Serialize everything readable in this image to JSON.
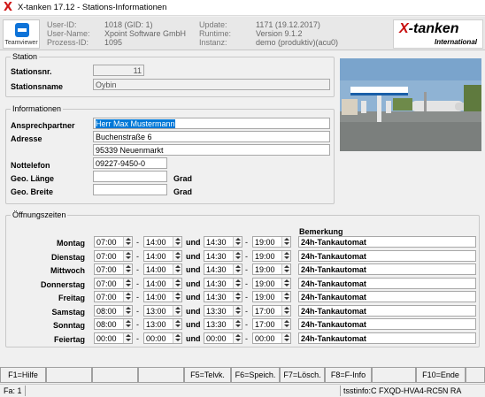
{
  "window": {
    "title": "X-tanken 17.12 - Stations-Informationen",
    "app_icon": "X"
  },
  "header": {
    "teamviewer_label": "Teamviewer",
    "labels_left": [
      "User-ID:",
      "User-Name:",
      "Prozess-ID:"
    ],
    "values_left": [
      "1018 (GID: 1)",
      "Xpoint Software GmbH",
      "1095"
    ],
    "labels_right": [
      "Update:",
      "Runtime:",
      "Instanz:"
    ],
    "values_right": [
      "1171 (19.12.2017)",
      "Version 9.1.2",
      "demo (produktiv)(acu0)"
    ],
    "logo_main_a": "X",
    "logo_main_b": "-tanken",
    "logo_sub": "International"
  },
  "station": {
    "legend": "Station",
    "nr_label": "Stationsnr.",
    "nr_value": "11",
    "name_label": "Stationsname",
    "name_value": "Oybin"
  },
  "info": {
    "legend": "Informationen",
    "contact_label": "Ansprechpartner",
    "contact_value": "Herr Max Mustermann",
    "address_label": "Adresse",
    "address_line1": "Buchenstraße 6",
    "address_line2": "95339 Neuenmarkt",
    "emergency_label": "Nottelefon",
    "emergency_value": "09227-9450-0",
    "geo_len_label": "Geo. Länge",
    "geo_len_value": "",
    "geo_len_unit": "Grad",
    "geo_br_label": "Geo. Breite",
    "geo_br_value": "",
    "geo_br_unit": "Grad"
  },
  "hours": {
    "legend": "Öffnungszeiten",
    "remark_header": "Bemerkung",
    "dash": "-",
    "and": "und",
    "rows": [
      {
        "day": "Montag",
        "t1": "07:00",
        "t2": "14:00",
        "t3": "14:30",
        "t4": "19:00",
        "remark": "24h-Tankautomat"
      },
      {
        "day": "Dienstag",
        "t1": "07:00",
        "t2": "14:00",
        "t3": "14:30",
        "t4": "19:00",
        "remark": "24h-Tankautomat"
      },
      {
        "day": "Mittwoch",
        "t1": "07:00",
        "t2": "14:00",
        "t3": "14:30",
        "t4": "19:00",
        "remark": "24h-Tankautomat"
      },
      {
        "day": "Donnerstag",
        "t1": "07:00",
        "t2": "14:00",
        "t3": "14:30",
        "t4": "19:00",
        "remark": "24h-Tankautomat"
      },
      {
        "day": "Freitag",
        "t1": "07:00",
        "t2": "14:00",
        "t3": "14:30",
        "t4": "19:00",
        "remark": "24h-Tankautomat"
      },
      {
        "day": "Samstag",
        "t1": "08:00",
        "t2": "13:00",
        "t3": "13:30",
        "t4": "17:00",
        "remark": "24h-Tankautomat"
      },
      {
        "day": "Sonntag",
        "t1": "08:00",
        "t2": "13:00",
        "t3": "13:30",
        "t4": "17:00",
        "remark": "24h-Tankautomat"
      },
      {
        "day": "Feiertag",
        "t1": "00:00",
        "t2": "00:00",
        "t3": "00:00",
        "t4": "00:00",
        "remark": "24h-Tankautomat"
      }
    ]
  },
  "fkeys": {
    "f1": "F1=Hilfe",
    "f5": "F5=Telvk.",
    "f6": "F6=Speich.",
    "f7": "F7=Lösch.",
    "f8": "F8=F-Info",
    "f10": "F10=Ende"
  },
  "status": {
    "left": "Fa: 1",
    "right": "tsstinfo:C FXQD-HVA4-RC5N RA"
  },
  "colors": {
    "selection": "#0078d7",
    "logo_red": "#c81010",
    "app_icon_red": "#d01818"
  }
}
